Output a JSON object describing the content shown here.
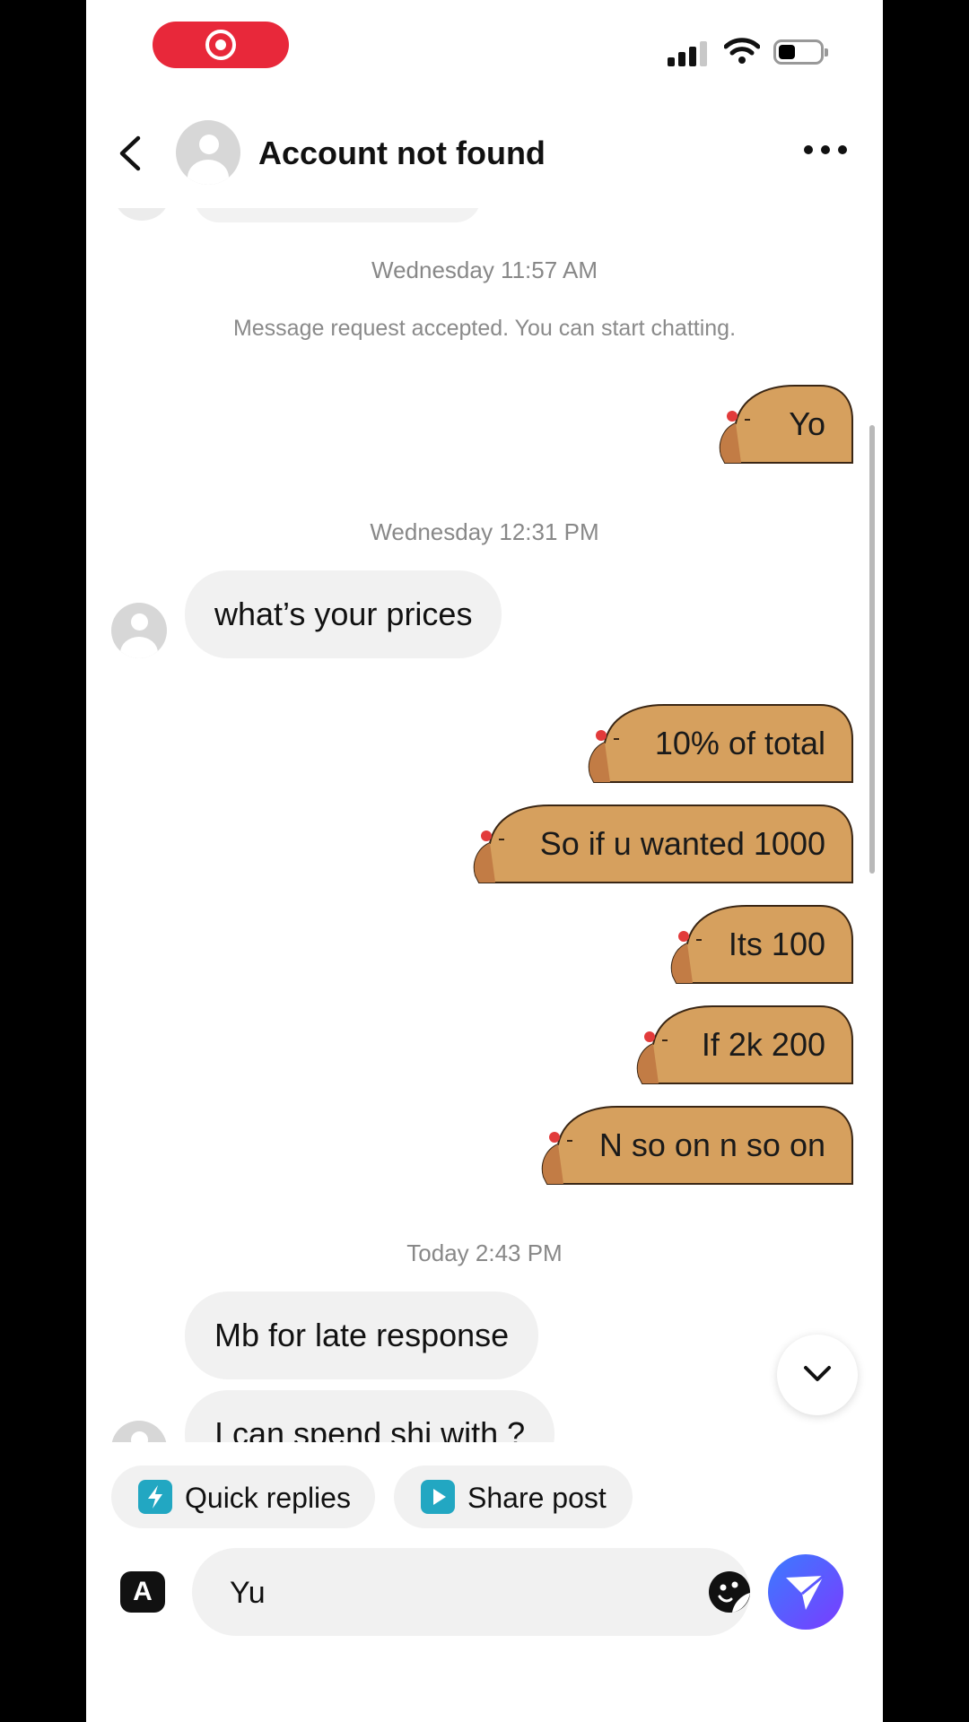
{
  "header": {
    "title": "Account not found"
  },
  "messages": {
    "ts1": "Wednesday 11:57 AM",
    "system_notice": "Message request accepted. You can start chatting.",
    "out1": "Yo",
    "ts2": "Wednesday 12:31 PM",
    "in1": "what’s your prices",
    "out2": "10% of total",
    "out3": "So if u wanted 1000",
    "out4": "Its 100",
    "out5": "If 2k 200",
    "out6": "N so on n so on",
    "ts3": "Today 2:43 PM",
    "in2": "Mb for late response",
    "in3": "I can spend shi with ?"
  },
  "quick_actions": {
    "quick_replies": "Quick replies",
    "share_post": "Share post"
  },
  "composer": {
    "value": "Yu",
    "keyboard_icon_label": "A"
  },
  "colors": {
    "accent": "#e8283a",
    "sticker": "#d6a05e",
    "send_start": "#3b7bff",
    "send_end": "#7a3cff"
  },
  "icons": [
    "record-icon",
    "signal-icon",
    "wifi-icon",
    "battery-icon",
    "back-icon",
    "more-icon",
    "chevron-down-icon",
    "bolt-icon",
    "play-icon",
    "sticker-icon",
    "send-icon"
  ]
}
